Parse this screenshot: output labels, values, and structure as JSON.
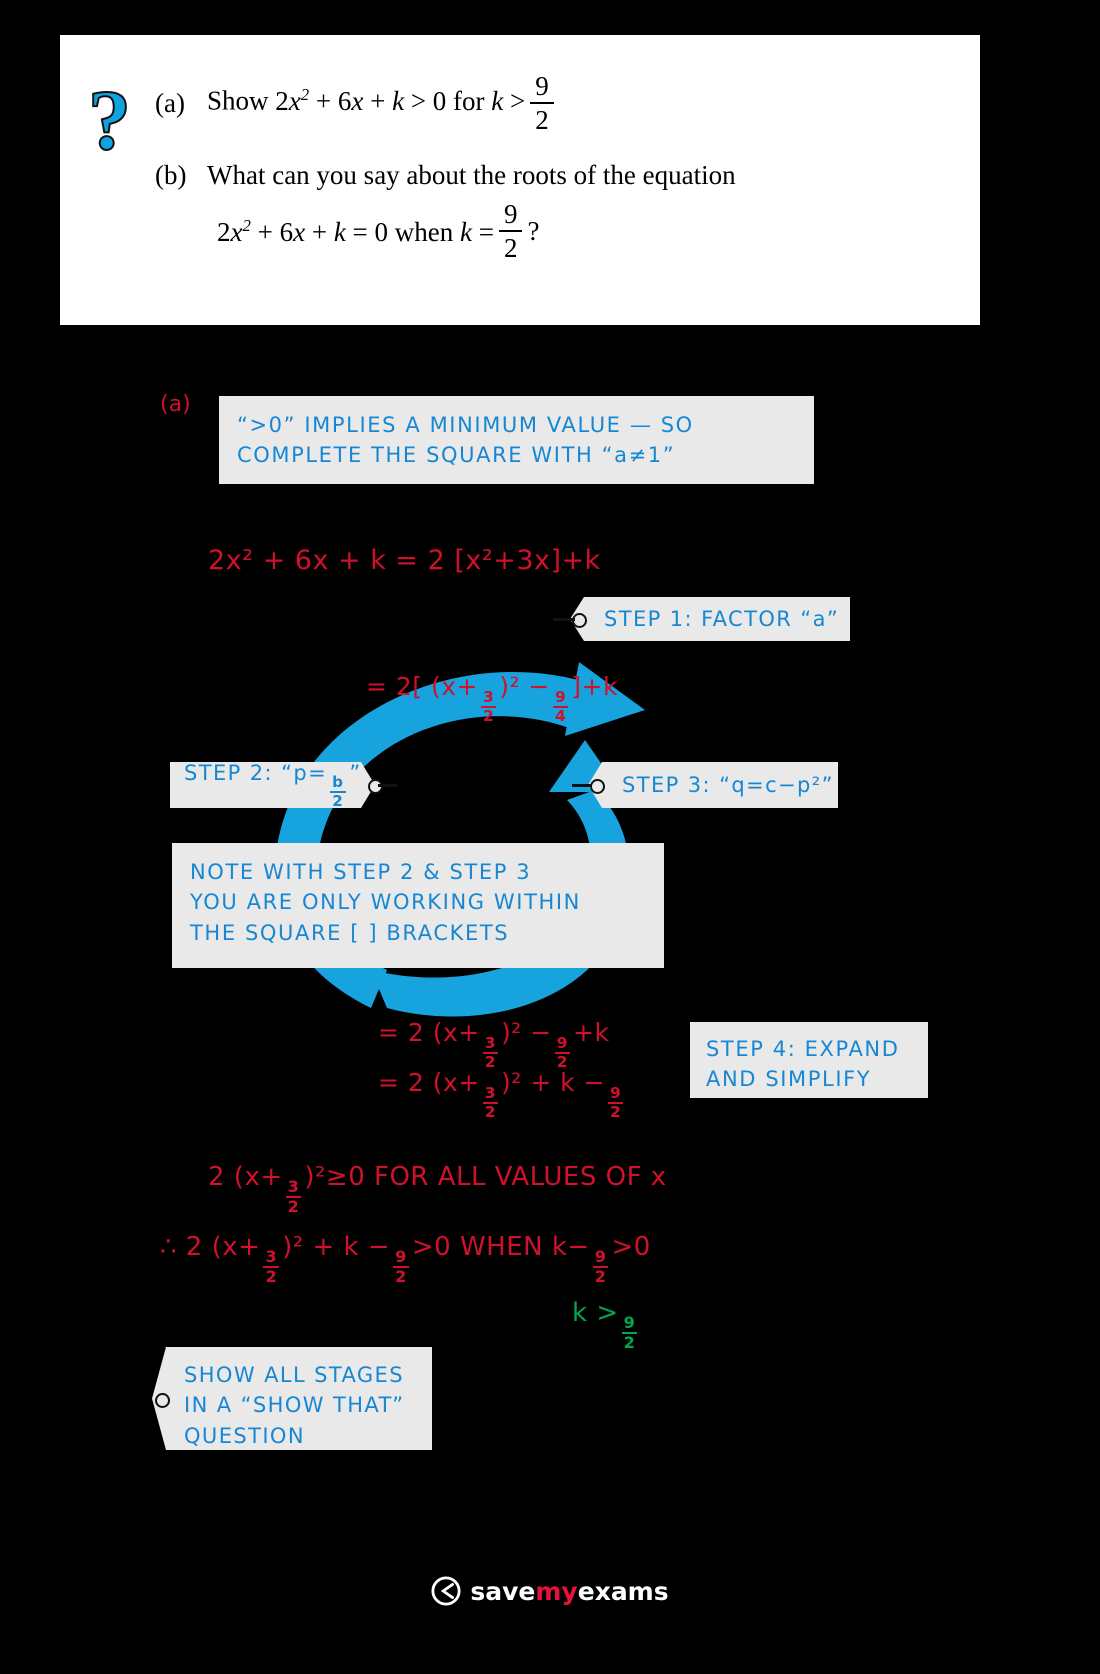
{
  "question": {
    "icon": "question-mark-icon",
    "parts": [
      {
        "label": "(a)",
        "text_before": "Show ",
        "expr": "2x² + 6x + k > 0 for k > ",
        "frac_num": "9",
        "frac_den": "2",
        "tail": ""
      },
      {
        "label": "(b)",
        "line1": "What can you say about the roots of the equation",
        "line2_before": "2x² + 6x + k = 0 when k = ",
        "frac_num": "9",
        "frac_den": "2",
        "tail": "?"
      }
    ]
  },
  "answer": {
    "part_label": "(a)",
    "hint_box": {
      "line1": "“>0”  IMPLIES   A   MINIMUM   VALUE  —  SO",
      "line2": "COMPLETE   THE   SQUARE   WITH   “a≠1”"
    },
    "line1": "2x² + 6x + k = 2 [x²+3x]+k",
    "step1": "STEP  1:  FACTOR  “a”",
    "line2_pre": "= 2[ (x+",
    "line2_f1n": "3",
    "line2_f1d": "2",
    "line2_mid": ")² −",
    "line2_f2n": "9",
    "line2_f2d": "4",
    "line2_post": "]+k",
    "step2_pre": "STEP  2:  “p=",
    "step2_fn": "b",
    "step2_fd": "2",
    "step2_post": "”",
    "step3": "STEP  3:  “q=c−p²”",
    "note_box": {
      "line1": "NOTE   WITH   STEP 2  &   STEP 3",
      "line2": "YOU   ARE   ONLY   WORKING   WITHIN",
      "line3": "THE   SQUARE   [ ]  BRACKETS"
    },
    "line3_pre": "= 2 (x+",
    "line3_f1n": "3",
    "line3_f1d": "2",
    "line3_mid": ")² −",
    "line3_f2n": "9",
    "line3_f2d": "2",
    "line3_post": "+k",
    "line4_pre": "= 2 (x+",
    "line4_f1n": "3",
    "line4_f1d": "2",
    "line4_mid": ")² + k −",
    "line4_f2n": "9",
    "line4_f2d": "2",
    "step4": {
      "line1": "STEP  4:  EXPAND",
      "line2": "AND   SIMPLIFY"
    },
    "line5_pre": "2 (x+",
    "line5_f1n": "3",
    "line5_f1d": "2",
    "line5_post": ")²≥0    FOR   ALL   VALUES  OF   x",
    "line6_sym": "∴",
    "line6_pre": " 2 (x+",
    "line6_f1n": "3",
    "line6_f1d": "2",
    "line6_mid": ")² + k −",
    "line6_f2n": "9",
    "line6_f2d": "2",
    "line6_post": ">0   WHEN   k−",
    "line6_f3n": "9",
    "line6_f3d": "2",
    "line6_tail": ">0",
    "final_pre": "k >",
    "final_fn": "9",
    "final_fd": "2",
    "tip_box": {
      "line1": "SHOW   ALL   STAGES",
      "line2": "IN  A  “SHOW  THAT”",
      "line3": "QUESTION"
    }
  },
  "footer": {
    "brand_save": "save",
    "brand_my": "my",
    "brand_exams": "exams"
  },
  "colors": {
    "accent_blue": "#1787d4",
    "cycle_blue": "#17a3de",
    "red": "#d0112b",
    "green": "#00a650",
    "note_bg": "#e9e9e9",
    "card_bg": "#ffffff",
    "page_bg": "#000000"
  }
}
